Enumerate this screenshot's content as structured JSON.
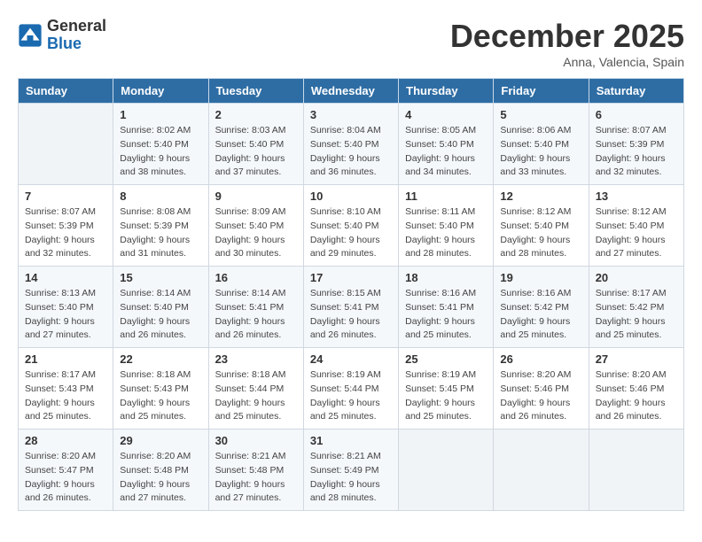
{
  "header": {
    "logo_general": "General",
    "logo_blue": "Blue",
    "month_title": "December 2025",
    "subtitle": "Anna, Valencia, Spain"
  },
  "days_of_week": [
    "Sunday",
    "Monday",
    "Tuesday",
    "Wednesday",
    "Thursday",
    "Friday",
    "Saturday"
  ],
  "weeks": [
    [
      {
        "day": "",
        "info": ""
      },
      {
        "day": "1",
        "info": "Sunrise: 8:02 AM\nSunset: 5:40 PM\nDaylight: 9 hours\nand 38 minutes."
      },
      {
        "day": "2",
        "info": "Sunrise: 8:03 AM\nSunset: 5:40 PM\nDaylight: 9 hours\nand 37 minutes."
      },
      {
        "day": "3",
        "info": "Sunrise: 8:04 AM\nSunset: 5:40 PM\nDaylight: 9 hours\nand 36 minutes."
      },
      {
        "day": "4",
        "info": "Sunrise: 8:05 AM\nSunset: 5:40 PM\nDaylight: 9 hours\nand 34 minutes."
      },
      {
        "day": "5",
        "info": "Sunrise: 8:06 AM\nSunset: 5:40 PM\nDaylight: 9 hours\nand 33 minutes."
      },
      {
        "day": "6",
        "info": "Sunrise: 8:07 AM\nSunset: 5:39 PM\nDaylight: 9 hours\nand 32 minutes."
      }
    ],
    [
      {
        "day": "7",
        "info": "Sunrise: 8:07 AM\nSunset: 5:39 PM\nDaylight: 9 hours\nand 32 minutes."
      },
      {
        "day": "8",
        "info": "Sunrise: 8:08 AM\nSunset: 5:39 PM\nDaylight: 9 hours\nand 31 minutes."
      },
      {
        "day": "9",
        "info": "Sunrise: 8:09 AM\nSunset: 5:40 PM\nDaylight: 9 hours\nand 30 minutes."
      },
      {
        "day": "10",
        "info": "Sunrise: 8:10 AM\nSunset: 5:40 PM\nDaylight: 9 hours\nand 29 minutes."
      },
      {
        "day": "11",
        "info": "Sunrise: 8:11 AM\nSunset: 5:40 PM\nDaylight: 9 hours\nand 28 minutes."
      },
      {
        "day": "12",
        "info": "Sunrise: 8:12 AM\nSunset: 5:40 PM\nDaylight: 9 hours\nand 28 minutes."
      },
      {
        "day": "13",
        "info": "Sunrise: 8:12 AM\nSunset: 5:40 PM\nDaylight: 9 hours\nand 27 minutes."
      }
    ],
    [
      {
        "day": "14",
        "info": "Sunrise: 8:13 AM\nSunset: 5:40 PM\nDaylight: 9 hours\nand 27 minutes."
      },
      {
        "day": "15",
        "info": "Sunrise: 8:14 AM\nSunset: 5:40 PM\nDaylight: 9 hours\nand 26 minutes."
      },
      {
        "day": "16",
        "info": "Sunrise: 8:14 AM\nSunset: 5:41 PM\nDaylight: 9 hours\nand 26 minutes."
      },
      {
        "day": "17",
        "info": "Sunrise: 8:15 AM\nSunset: 5:41 PM\nDaylight: 9 hours\nand 26 minutes."
      },
      {
        "day": "18",
        "info": "Sunrise: 8:16 AM\nSunset: 5:41 PM\nDaylight: 9 hours\nand 25 minutes."
      },
      {
        "day": "19",
        "info": "Sunrise: 8:16 AM\nSunset: 5:42 PM\nDaylight: 9 hours\nand 25 minutes."
      },
      {
        "day": "20",
        "info": "Sunrise: 8:17 AM\nSunset: 5:42 PM\nDaylight: 9 hours\nand 25 minutes."
      }
    ],
    [
      {
        "day": "21",
        "info": "Sunrise: 8:17 AM\nSunset: 5:43 PM\nDaylight: 9 hours\nand 25 minutes."
      },
      {
        "day": "22",
        "info": "Sunrise: 8:18 AM\nSunset: 5:43 PM\nDaylight: 9 hours\nand 25 minutes."
      },
      {
        "day": "23",
        "info": "Sunrise: 8:18 AM\nSunset: 5:44 PM\nDaylight: 9 hours\nand 25 minutes."
      },
      {
        "day": "24",
        "info": "Sunrise: 8:19 AM\nSunset: 5:44 PM\nDaylight: 9 hours\nand 25 minutes."
      },
      {
        "day": "25",
        "info": "Sunrise: 8:19 AM\nSunset: 5:45 PM\nDaylight: 9 hours\nand 25 minutes."
      },
      {
        "day": "26",
        "info": "Sunrise: 8:20 AM\nSunset: 5:46 PM\nDaylight: 9 hours\nand 26 minutes."
      },
      {
        "day": "27",
        "info": "Sunrise: 8:20 AM\nSunset: 5:46 PM\nDaylight: 9 hours\nand 26 minutes."
      }
    ],
    [
      {
        "day": "28",
        "info": "Sunrise: 8:20 AM\nSunset: 5:47 PM\nDaylight: 9 hours\nand 26 minutes."
      },
      {
        "day": "29",
        "info": "Sunrise: 8:20 AM\nSunset: 5:48 PM\nDaylight: 9 hours\nand 27 minutes."
      },
      {
        "day": "30",
        "info": "Sunrise: 8:21 AM\nSunset: 5:48 PM\nDaylight: 9 hours\nand 27 minutes."
      },
      {
        "day": "31",
        "info": "Sunrise: 8:21 AM\nSunset: 5:49 PM\nDaylight: 9 hours\nand 28 minutes."
      },
      {
        "day": "",
        "info": ""
      },
      {
        "day": "",
        "info": ""
      },
      {
        "day": "",
        "info": ""
      }
    ]
  ]
}
